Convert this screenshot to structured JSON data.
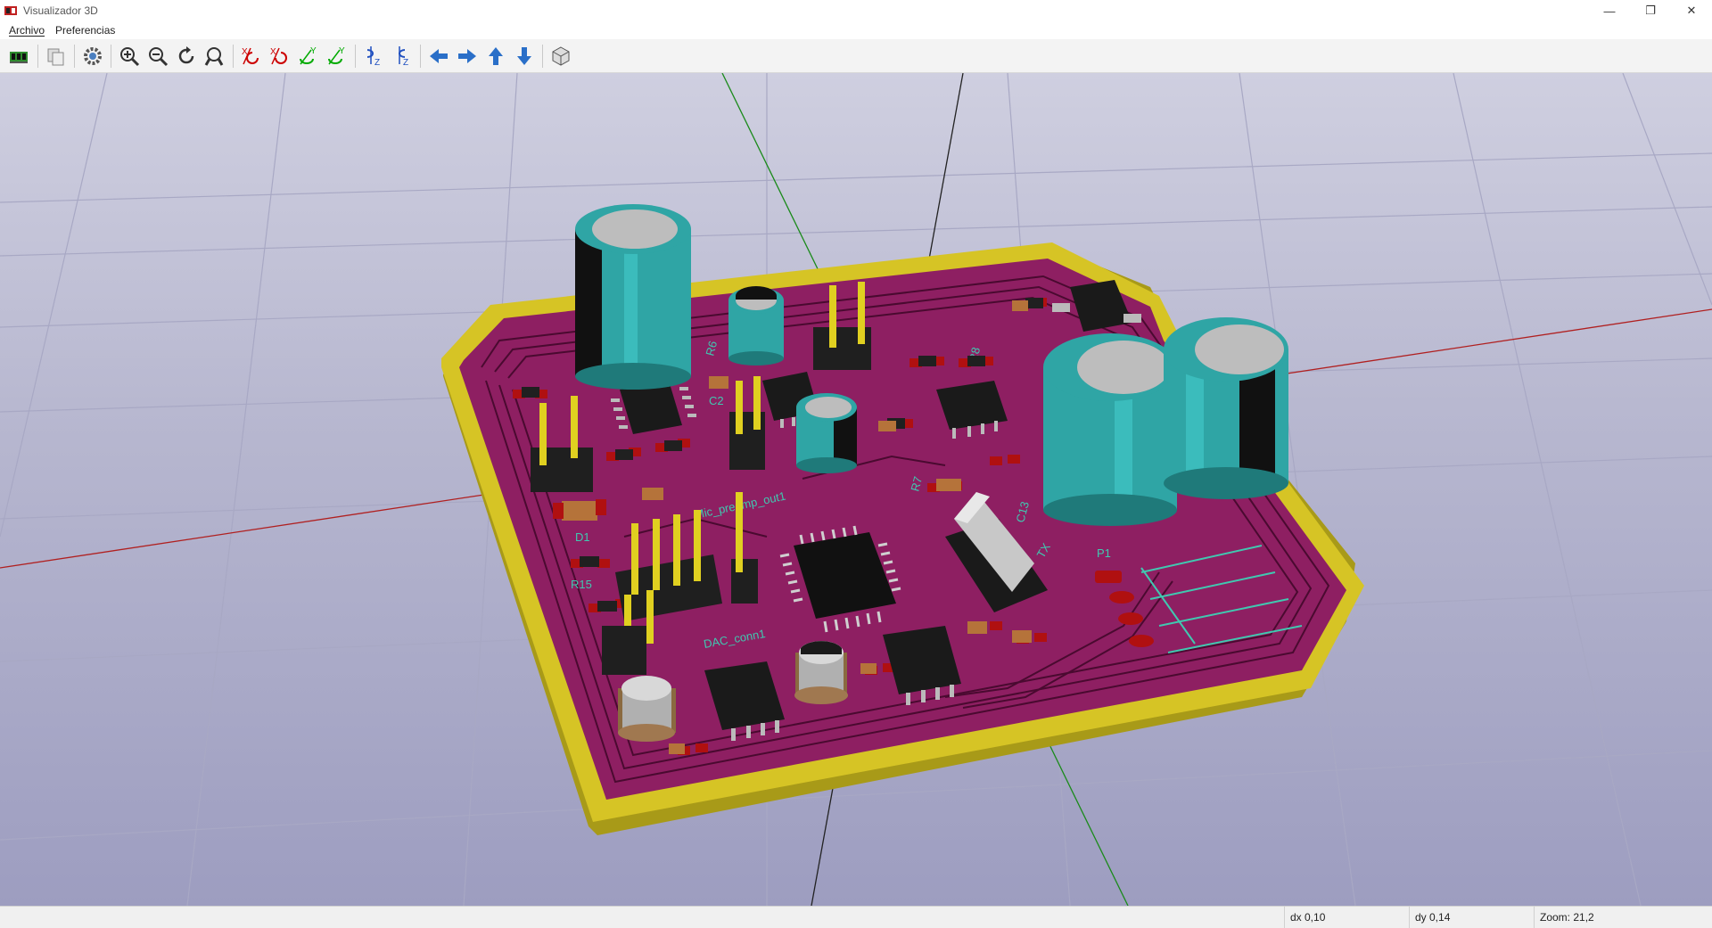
{
  "window": {
    "title": "Visualizador 3D",
    "minimize_glyph": "—",
    "restore_glyph": "❐",
    "close_glyph": "✕"
  },
  "menu": {
    "archivo": "Archivo",
    "preferencias": "Preferencias"
  },
  "toolbar": {
    "icons": [
      "reload-board-icon",
      "copy-icon",
      "settings-icon",
      "zoom-in-icon",
      "zoom-out-icon",
      "redraw-icon",
      "zoom-fit-icon",
      "rotate-x-cw-icon",
      "rotate-x-ccw-icon",
      "rotate-y-cw-icon",
      "rotate-y-ccw-icon",
      "rotate-z-cw-icon",
      "rotate-z-ccw-icon",
      "move-left-icon",
      "move-right-icon",
      "move-up-icon",
      "move-down-icon",
      "orthographic-icon"
    ]
  },
  "board": {
    "labels": {
      "d1": "D1",
      "r15": "R15",
      "p1": "P1",
      "c13": "C13",
      "dac_conn": "DAC_conn1",
      "mic_preamp": "Mic_preamp_out1",
      "c2": "C2",
      "r8": "R8",
      "r6": "R6",
      "r7": "R7",
      "tx": "TX"
    },
    "colors": {
      "soldermask": "#8e1f62",
      "edge": "#c9b820",
      "silkscreen": "#40c8b0",
      "capacitor": "#2fa5a5"
    }
  },
  "status": {
    "dx": "dx 0,10",
    "dy": "dy 0,14",
    "zoom": "Zoom: 21,2"
  }
}
